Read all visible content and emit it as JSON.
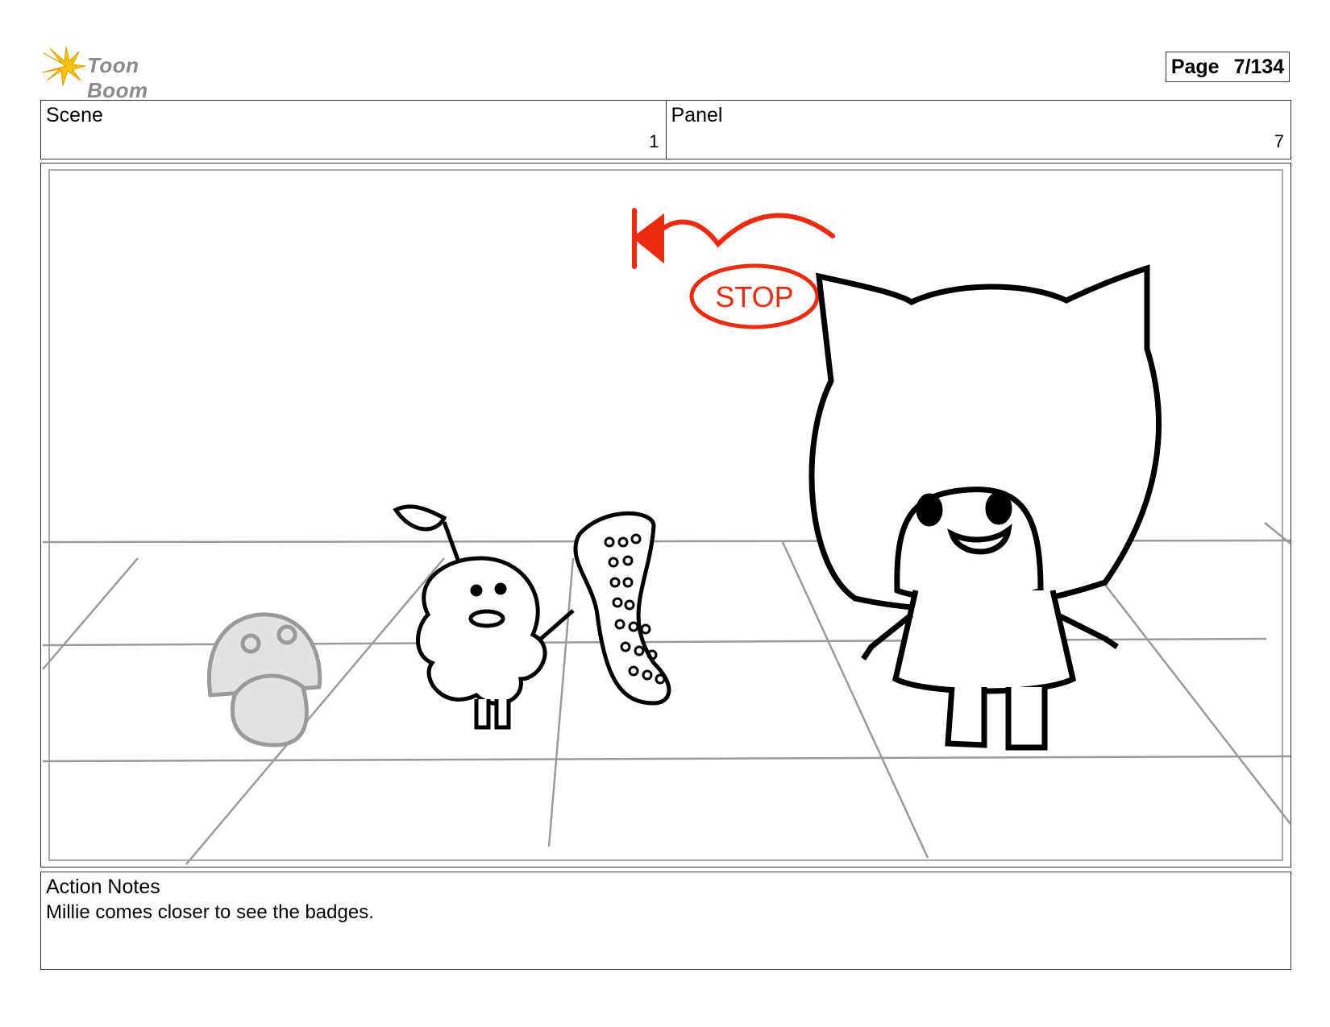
{
  "header": {
    "logo_text": "Toon Boom",
    "page_label": "Page",
    "page_value": "7/134"
  },
  "info": {
    "scene_label": "Scene",
    "scene_value": "1",
    "panel_label": "Panel",
    "panel_value": "7"
  },
  "drawing": {
    "annotation_text": "STOP",
    "annotation_color": "#ee2a10"
  },
  "notes": {
    "label": "Action Notes",
    "text": "Millie comes closer to see the badges."
  }
}
